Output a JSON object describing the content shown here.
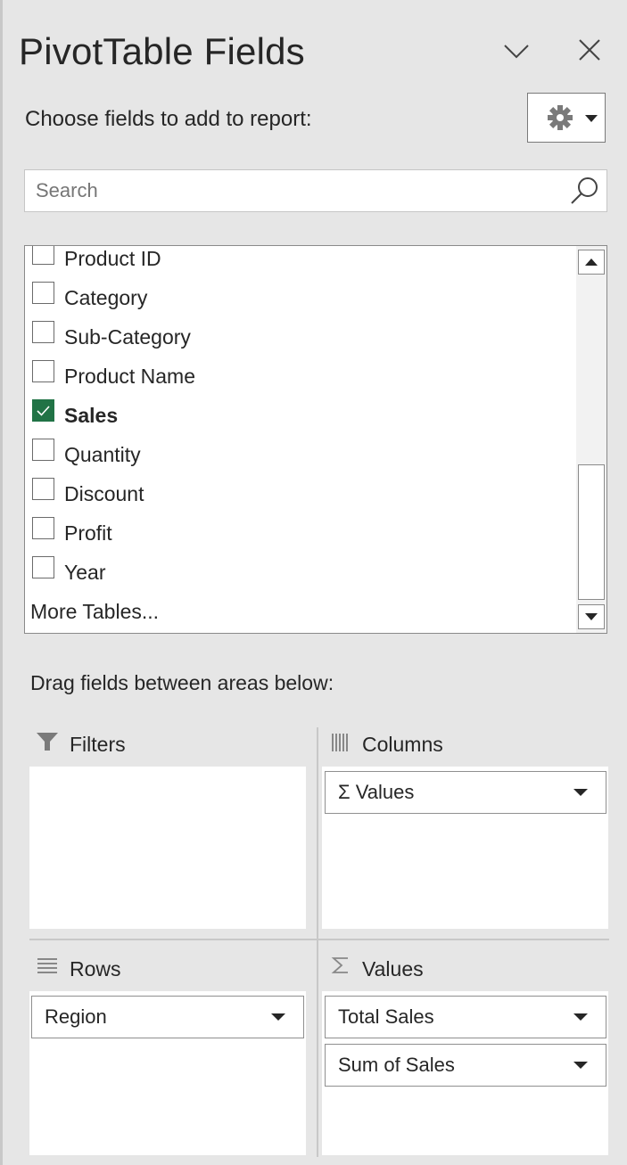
{
  "panel": {
    "title": "PivotTable Fields",
    "choose_label": "Choose fields to add to report:",
    "search_placeholder": "Search",
    "icons": {
      "collapse": "chevron-down-icon",
      "close": "close-icon",
      "settings": "gear-icon",
      "search": "search-icon"
    },
    "accent_color": "#217346"
  },
  "fields": [
    {
      "label": "Product ID",
      "checked": false
    },
    {
      "label": "Category",
      "checked": false
    },
    {
      "label": "Sub-Category",
      "checked": false
    },
    {
      "label": "Product Name",
      "checked": false
    },
    {
      "label": "Sales",
      "checked": true
    },
    {
      "label": "Quantity",
      "checked": false
    },
    {
      "label": "Discount",
      "checked": false
    },
    {
      "label": "Profit",
      "checked": false
    },
    {
      "label": "Year",
      "checked": false
    }
  ],
  "more_tables": "More Tables...",
  "drag_label": "Drag fields between areas below:",
  "areas": {
    "filters": {
      "title": "Filters",
      "icon": "filter-icon",
      "items": []
    },
    "columns": {
      "title": "Columns",
      "icon": "columns-icon",
      "items": [
        "Σ Values"
      ]
    },
    "rows": {
      "title": "Rows",
      "icon": "rows-icon",
      "items": [
        "Region"
      ]
    },
    "values": {
      "title": "Values",
      "icon": "sigma-icon",
      "items": [
        "Total Sales",
        "Sum of Sales"
      ]
    }
  }
}
